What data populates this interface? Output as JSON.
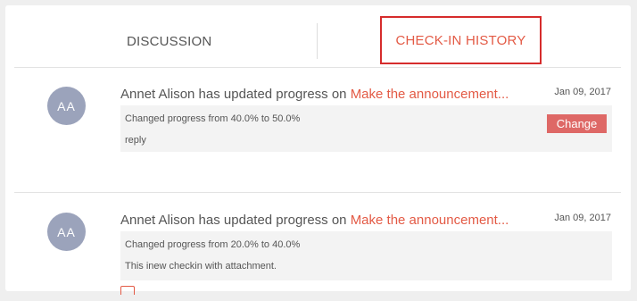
{
  "tabs": {
    "discussion": "DISCUSSION",
    "checkin_history": "CHECK-IN HISTORY"
  },
  "entries": [
    {
      "avatar": "AA",
      "user": "Annet Alison has updated progress on ",
      "link": "Make the announcement...",
      "date": "Jan 09, 2017",
      "detail": "Changed progress from 40.0% to 50.0%",
      "note": "reply",
      "button": "Change"
    },
    {
      "avatar": "AA",
      "user": "Annet Alison has updated progress on ",
      "link": "Make the announcement...",
      "date": "Jan 09, 2017",
      "detail": "Changed progress from 20.0% to 40.0%",
      "note": "This inew checkin with attachment.",
      "attachment_icon": "attachment-icon"
    }
  ],
  "colors": {
    "accent": "#e35a45",
    "active_tab_border": "#d62c2c",
    "button": "#de6866",
    "avatar": "#9ba3bb"
  }
}
